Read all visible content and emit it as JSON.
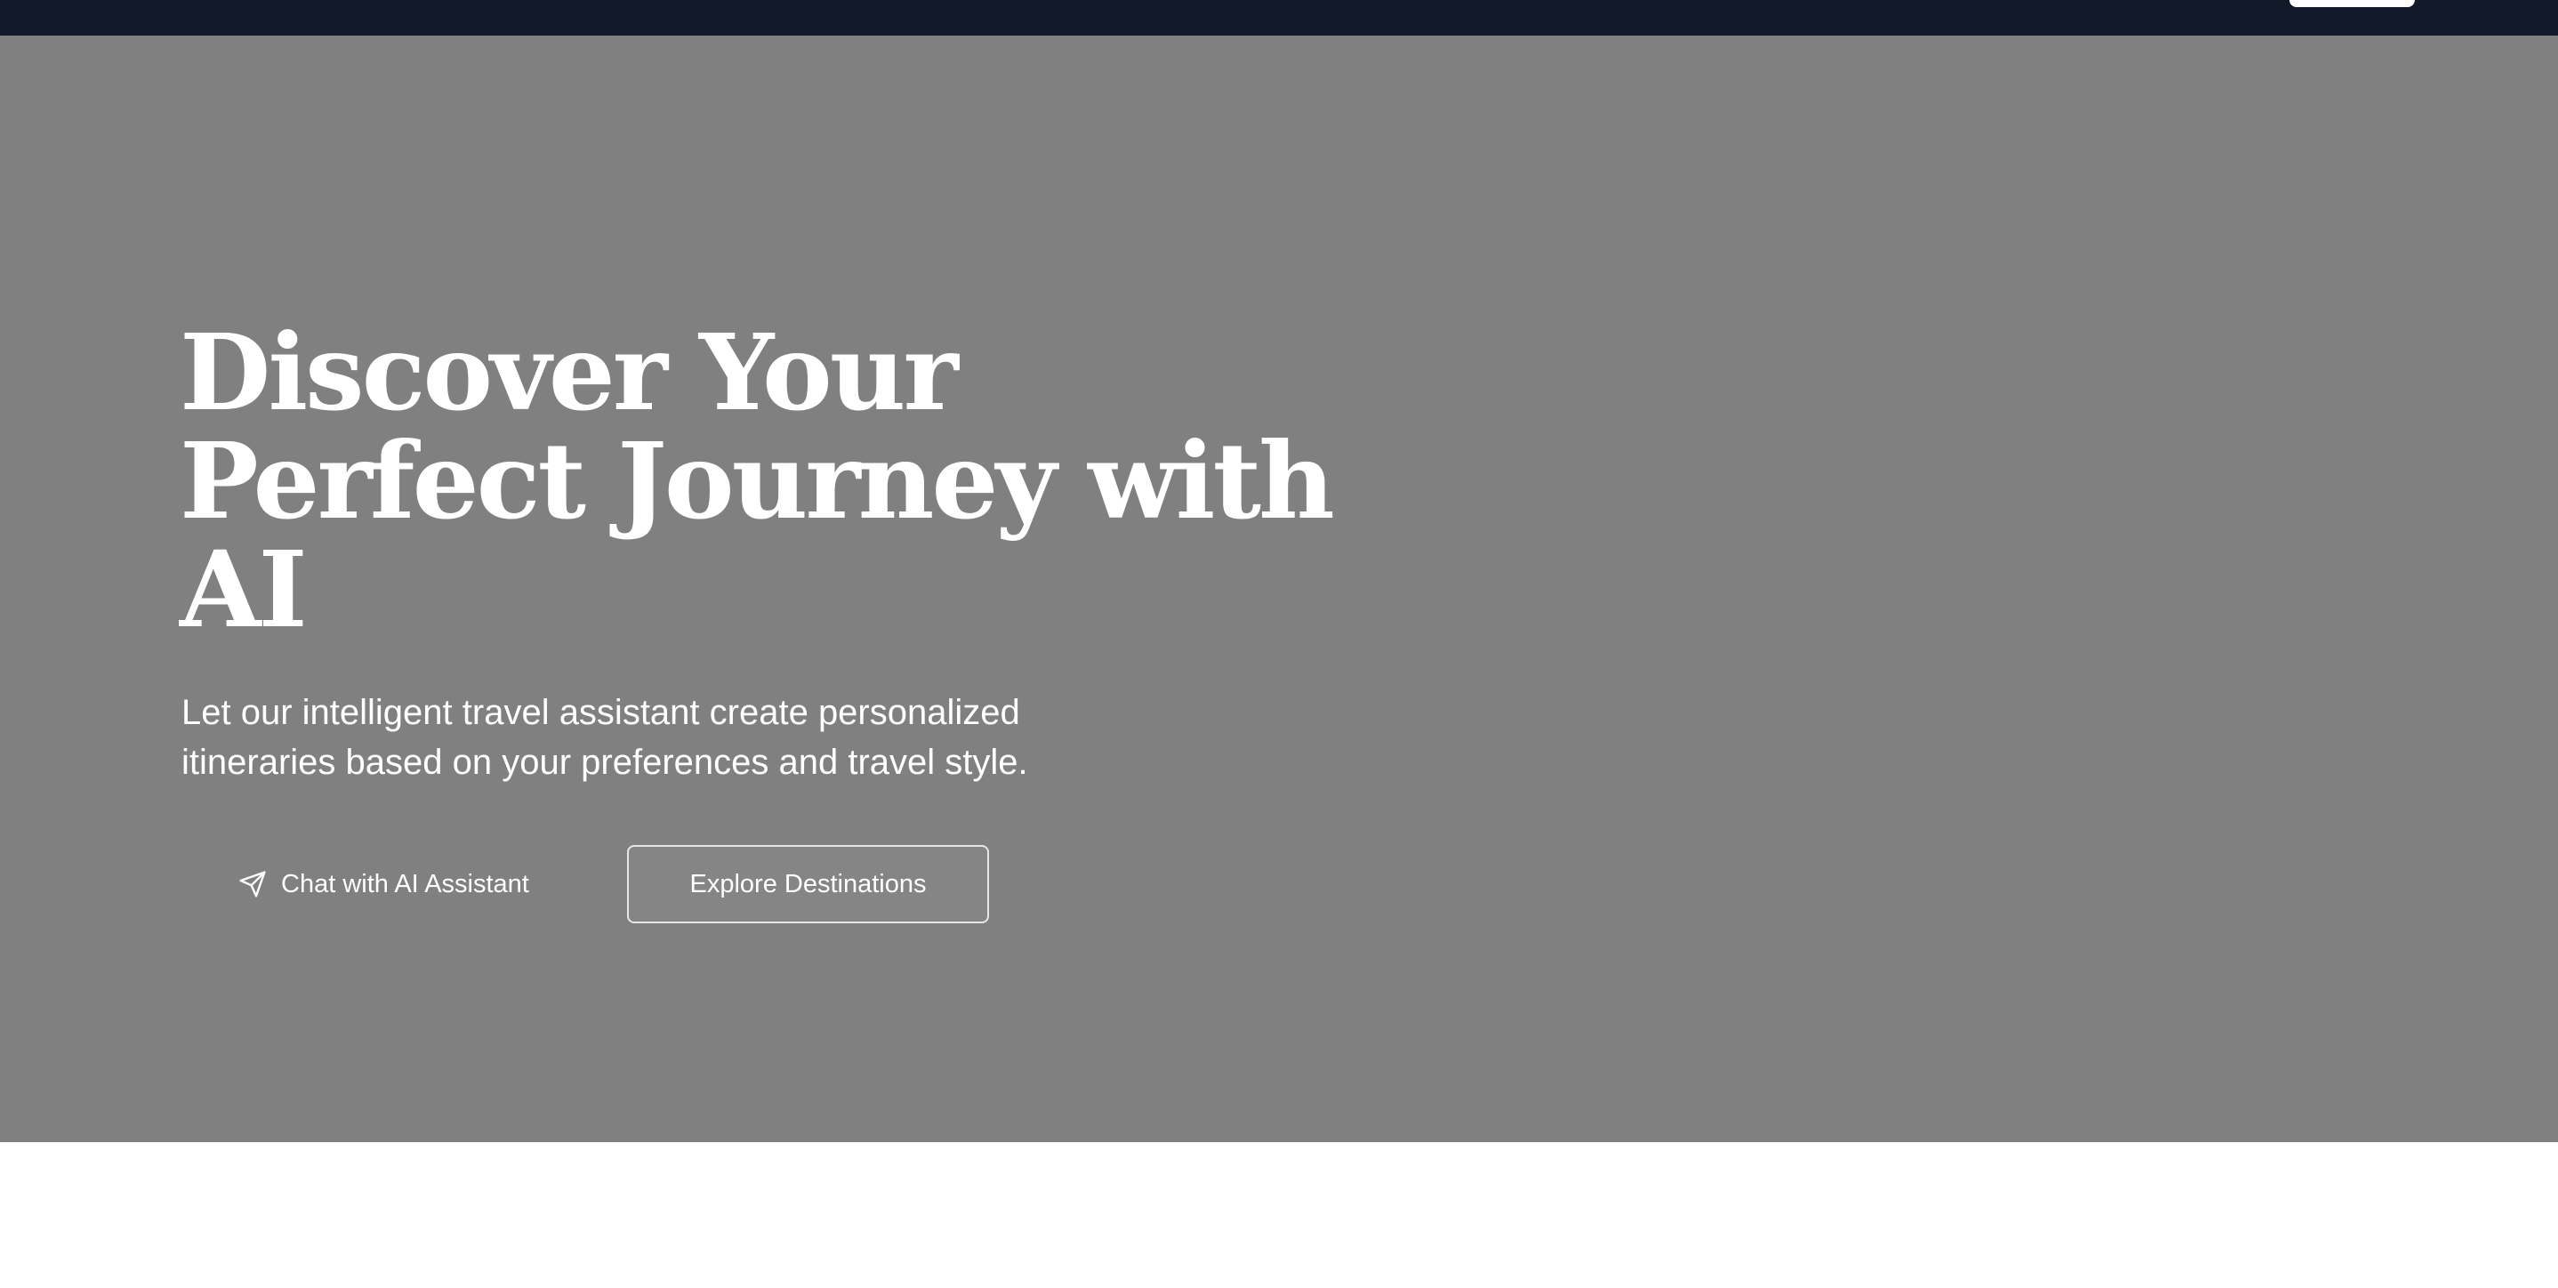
{
  "colors": {
    "topbar_bg": "#111827",
    "hero_bg": "#808080",
    "text": "#ffffff",
    "below_bg": "#ffffff"
  },
  "hero": {
    "title_lines": [
      "Discover Your",
      "Perfect Journey with",
      "AI"
    ],
    "subtitle_lines": [
      "Let our intelligent travel assistant create personalized",
      "itineraries based on your preferences and travel style."
    ],
    "primary_button": {
      "label": "Chat with AI Assistant",
      "icon": "send-icon"
    },
    "secondary_button": {
      "label": "Explore Destinations"
    }
  }
}
